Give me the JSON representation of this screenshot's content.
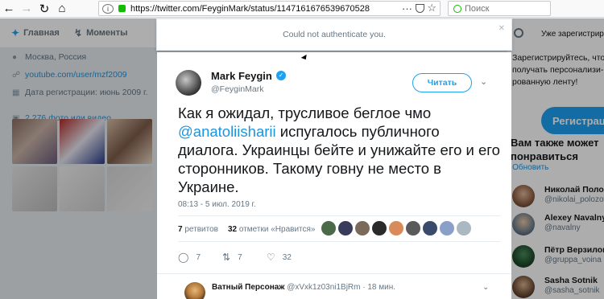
{
  "browser": {
    "url": "https://twitter.com/FeyginMark/status/1147161676539670528",
    "search_placeholder": "Поиск",
    "menu_glyph": "···"
  },
  "twitter_nav": {
    "home_label": "Главная",
    "moments_label": "Моменты"
  },
  "profile": {
    "location": "Москва, Россия",
    "website": "youtube.com/user/mzf2009",
    "joined": "Дата регистрации: июнь 2009 г.",
    "photos": "2 276 фото или видео"
  },
  "notice": {
    "message": "Could not authenticate you."
  },
  "tweet": {
    "author_name": "Mark Feygin",
    "author_handle": "@FeyginMark",
    "follow_label": "Читать",
    "text_before": "Как я ожидал, трусливое беглое чмо",
    "mention": "@anatoliisharii",
    "text_after": "испугалось публичного диалога. Украинцы бейте и унижайте его и его сторонников. Такому говну не место в Украине.",
    "timestamp": "08:13 - 5 июл. 2019 г.",
    "retweets_count": "7",
    "retweets_label": "ретвитов",
    "likes_count": "32",
    "likes_label": "отметки «Нравится»",
    "replies_action": "7",
    "retweet_action": "7",
    "like_action": "32"
  },
  "reply": {
    "author_name": "Ватный Персонаж",
    "author_handle": "@xVxk1z03ni1BjRm",
    "time": "· 18 мин."
  },
  "sidebar": {
    "registered_note": "Уже зарегистрированы?",
    "promo_lines": [
      "Зарегистрируйтесь, чтобы",
      "получать персонализи-",
      "рованную ленту!"
    ],
    "register_label": "Регистрация",
    "wtf_title_1": "Вам также может",
    "wtf_title_2": "понравиться",
    "refresh": "· Обновить",
    "suggestions": [
      {
        "name": "Николай Полозов",
        "handle": "@nikolai_polozov"
      },
      {
        "name": "Alexey Navalny",
        "handle": "@navalny"
      },
      {
        "name": "Пётр Верзилов",
        "handle": "@gruppa_voina"
      },
      {
        "name": "Sasha Sotnik",
        "handle": "@sasha_sotnik"
      }
    ]
  }
}
